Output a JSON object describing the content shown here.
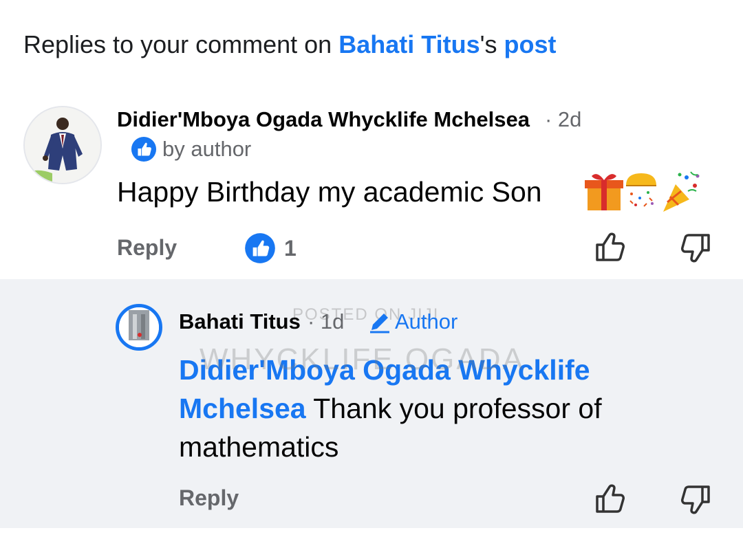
{
  "header": {
    "prefix": "Replies to your comment on ",
    "post_author": "Bahati Titus",
    "possessive": "'s ",
    "post_link": "post"
  },
  "comment": {
    "author": "Didier'Mboya Ogada Whycklife Mchelsea",
    "time": "· 2d",
    "liked_by_author": "by author",
    "text": "Happy Birthday my academic Son",
    "emojis": [
      "gift-emoji",
      "confetti-ball-emoji",
      "party-popper-emoji"
    ],
    "reply_label": "Reply",
    "like_count": "1"
  },
  "reply": {
    "author": "Bahati Titus",
    "time": "· 1d",
    "author_badge": "Author",
    "mention": "Didier'Mboya Ogada Whycklife Mchelsea",
    "text": " Thank you professor of mathematics",
    "reply_label": "Reply",
    "watermark_top": "POSTED ON JIJI",
    "watermark_main": "WHYCKLIFE OGADA"
  },
  "icons": {
    "like": "thumbs-up-outline-icon",
    "dislike": "thumbs-down-outline-icon",
    "like_badge": "like-reaction-icon",
    "author_badge": "pencil-icon"
  },
  "colors": {
    "accent": "#1877f2",
    "secondary_text": "#65676b",
    "reply_background": "#f0f2f5"
  }
}
